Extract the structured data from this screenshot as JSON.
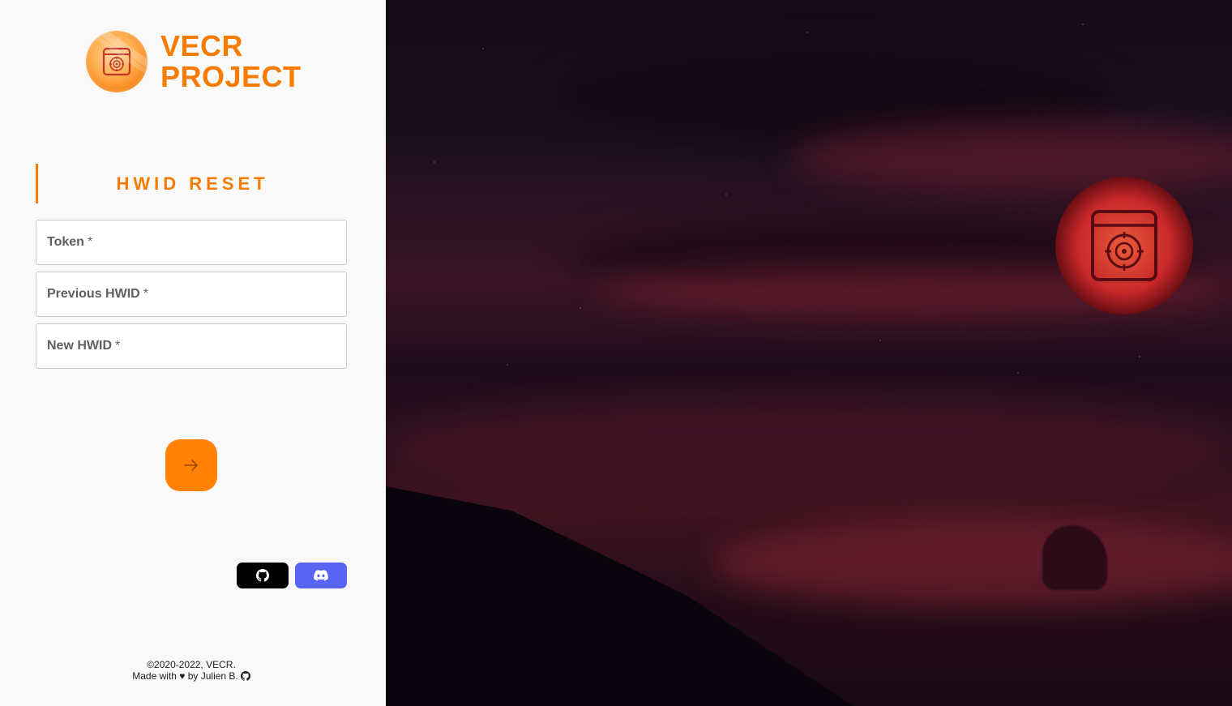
{
  "brand": {
    "line1": "VECR",
    "line2": "PROJECT",
    "accent_color": "#f57c00",
    "logo_icon": "safe-vault-icon"
  },
  "form": {
    "title": "HWID RESET",
    "fields": [
      {
        "label": "Token",
        "required_mark": "*"
      },
      {
        "label": "Previous HWID",
        "required_mark": "*"
      },
      {
        "label": "New HWID",
        "required_mark": "*"
      }
    ],
    "submit_icon": "arrow-right-icon",
    "submit_color": "#ff8205"
  },
  "social": {
    "github_icon": "github-icon",
    "github_color": "#000000",
    "discord_icon": "discord-icon",
    "discord_color": "#5865f2"
  },
  "footer": {
    "copyright": "©2020-2022, VECR.",
    "made_with": "Made with ♥ by Julien B.",
    "github_icon": "github-icon"
  },
  "background": {
    "badge_icon": "safe-vault-icon"
  }
}
